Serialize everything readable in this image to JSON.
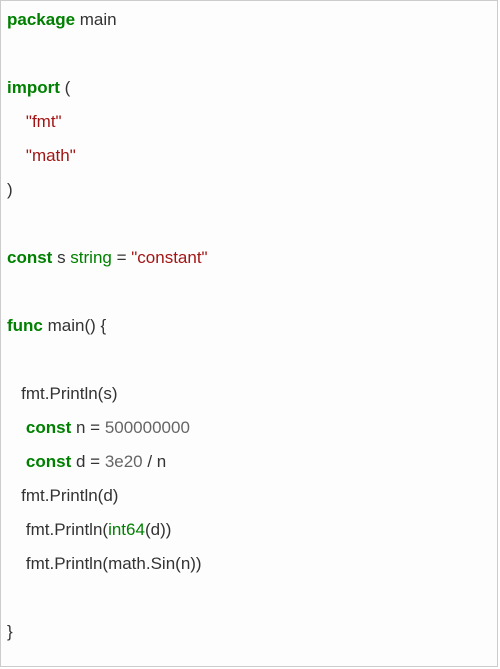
{
  "code": {
    "l1_kw": "package",
    "l1_id": " main",
    "l3_kw": "import",
    "l3_rest": " (",
    "l4_str": "\"fmt\"",
    "l5_str": "\"math\"",
    "l6": ")",
    "l8_kw": "const",
    "l8_id": " s ",
    "l8_type": "string",
    "l8_eq": " = ",
    "l8_str": "\"constant\"",
    "l10_kw": "func",
    "l10_rest": " main() {",
    "l12": "   fmt.Println(s)",
    "l13_pre": "    ",
    "l13_kw": "const",
    "l13_mid": " n = ",
    "l13_num": "500000000",
    "l14_pre": "    ",
    "l14_kw": "const",
    "l14_mid": " d = ",
    "l14_num": "3e20",
    "l14_post": " / n",
    "l15": "   fmt.Println(d)",
    "l16_pre": "    fmt.Println(",
    "l16_type": "int64",
    "l16_post": "(d))",
    "l17": "    fmt.Println(math.Sin(n))",
    "l19": "}"
  }
}
